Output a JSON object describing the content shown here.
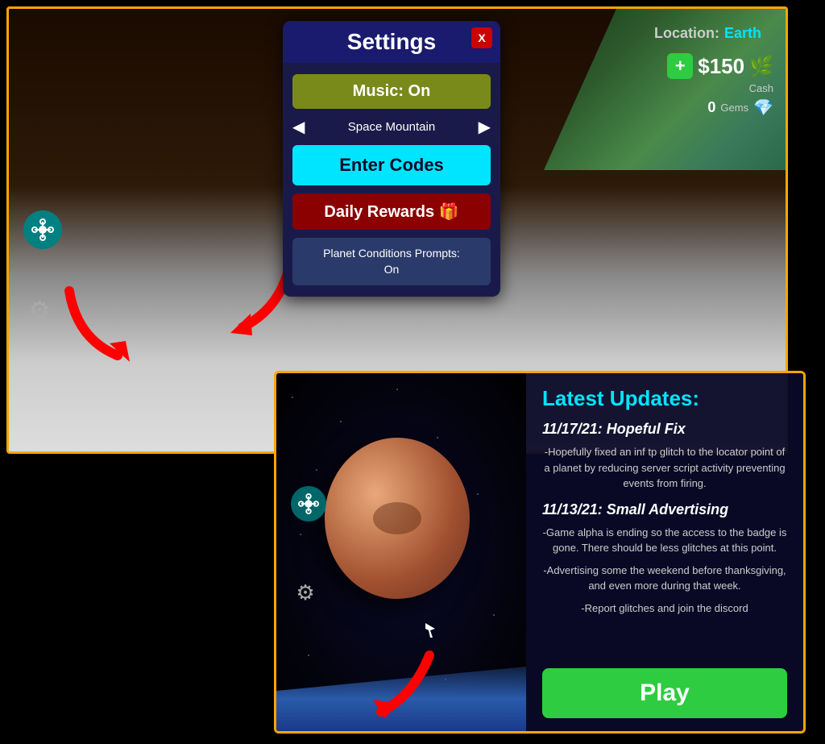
{
  "topScene": {
    "location": {
      "label": "Location:",
      "value": "Earth"
    },
    "currency": {
      "cashAmount": "$150",
      "cashLabel": "Cash",
      "cashIcon": "🌿",
      "plusLabel": "+",
      "gemsAmount": "0",
      "gemsLabel": "Gems"
    },
    "leftIcons": {
      "droneIcon": "⊛",
      "gearIcon": "⚙"
    }
  },
  "settingsModal": {
    "title": "Settings",
    "closeLabel": "X",
    "musicButton": "Music: On",
    "trackName": "Space Mountain",
    "prevTrackLabel": "◀",
    "nextTrackLabel": "▶",
    "enterCodesLabel": "Enter Codes",
    "dailyRewardsLabel": "Daily Rewards 🎁",
    "planetConditionsLabel": "Planet Conditions Prompts:\nOn"
  },
  "bottomPanel": {
    "updatesTitle": "Latest Updates:",
    "update1Date": "11/17/21: Hopeful Fix",
    "update1Text": "-Hopefully fixed an inf tp glitch to the locator point of a planet by reducing server script activity preventing events from firing.",
    "update2Date": "11/13/21: Small Advertising",
    "update2Text1": "-Game alpha is ending so the access to the badge is gone. There should be less glitches at this point.",
    "update2Text2": "-Advertising some the weekend before thanksgiving, and even more during that week.",
    "update2Text3": "-Report glitches and join the discord",
    "playLabel": "Play"
  }
}
